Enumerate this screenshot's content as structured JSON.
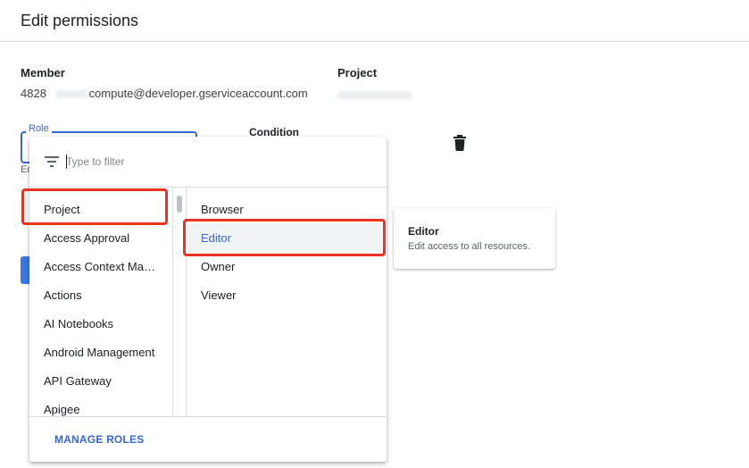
{
  "header": {
    "title": "Edit permissions"
  },
  "member": {
    "label": "Member",
    "id_prefix": "4828",
    "email_suffix": "compute@developer.gserviceaccount.com"
  },
  "project": {
    "label": "Project"
  },
  "role_field": {
    "label": "Role",
    "helper_stub": "Ed"
  },
  "condition": {
    "label": "Condition"
  },
  "filter": {
    "placeholder": "Type to filter",
    "value": ""
  },
  "categories": [
    "Project",
    "Access Approval",
    "Access Context Man…",
    "Actions",
    "AI Notebooks",
    "Android Management",
    "API Gateway",
    "Apigee"
  ],
  "roles": [
    "Browser",
    "Editor",
    "Owner",
    "Viewer"
  ],
  "selected_category": "Project",
  "selected_role": "Editor",
  "manage_roles_label": "MANAGE ROLES",
  "role_description": {
    "title": "Editor",
    "text": "Edit access to all resources."
  },
  "colors": {
    "accent": "#3367d6",
    "annotation": "#ea3323"
  }
}
